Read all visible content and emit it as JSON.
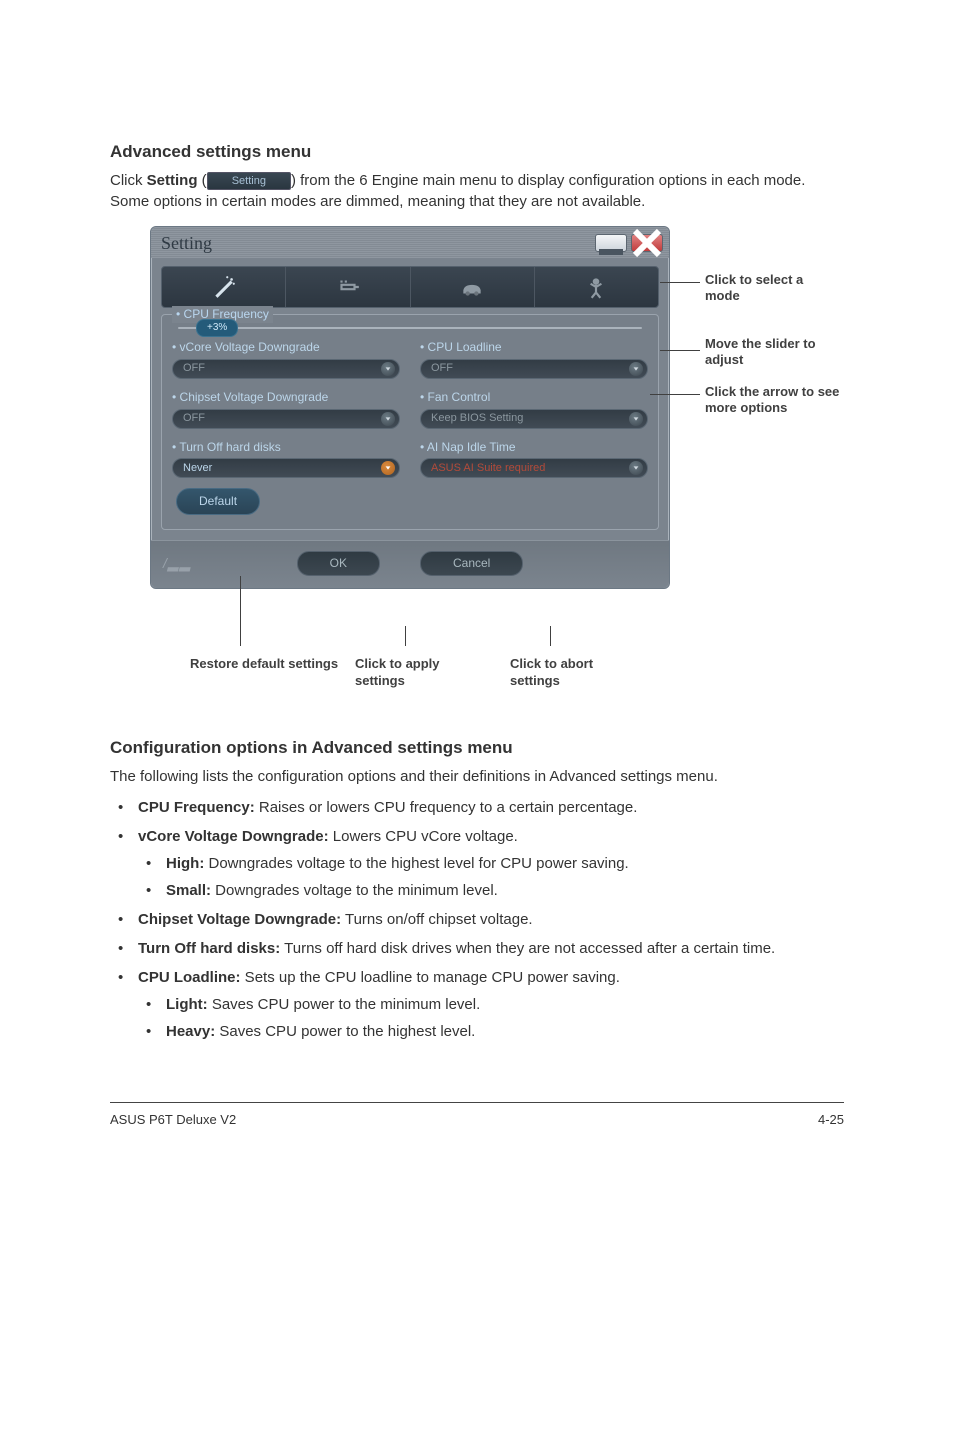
{
  "section1_title": "Advanced settings menu",
  "section1_p_prefix": "Click ",
  "section1_p_bold": "Setting",
  "section1_p_open": " (",
  "setting_btn_label": "Setting",
  "section1_p_rest": ") from the 6 Engine main menu to display configuration options in each mode. Some options in certain modes are dimmed, meaning that they are not available.",
  "window": {
    "title": "Setting",
    "group_title": "• CPU Frequency",
    "slider_value": "+3%",
    "opts": {
      "vcore_label": "• vCore Voltage Downgrade",
      "vcore_value": "OFF",
      "loadline_label": "• CPU Loadline",
      "loadline_value": "OFF",
      "chipset_label": "• Chipset Voltage Downgrade",
      "chipset_value": "OFF",
      "fan_label": "• Fan Control",
      "fan_value": "Keep BIOS Setting",
      "turnoff_label": "• Turn Off hard disks",
      "turnoff_value": "Never",
      "ainap_label": "• AI Nap Idle Time",
      "ainap_value": "ASUS AI Suite required"
    },
    "default_btn": "Default",
    "ok_btn": "OK",
    "cancel_btn": "Cancel"
  },
  "callouts": {
    "select_mode": "Click to select a mode",
    "move_slider": "Move the slider to adjust",
    "click_arrow": "Click the arrow to see more options",
    "restore": "Restore default settings",
    "apply": "Click to apply settings",
    "abort": "Click to abort settings"
  },
  "section2_title": "Configuration options in Advanced settings menu",
  "section2_p": "The following lists the configuration options and their definitions in Advanced settings menu.",
  "bullets": {
    "cpu_freq_b": "CPU Frequency:",
    "cpu_freq_t": " Raises or lowers CPU frequency to a certain percentage.",
    "vcore_b": "vCore Voltage Downgrade:",
    "vcore_t": " Lowers CPU vCore voltage.",
    "high_b": "High:",
    "high_t": " Downgrades voltage to the highest level for CPU power saving.",
    "small_b": "Small:",
    "small_t": " Downgrades voltage to the minimum level.",
    "chipset_b": "Chipset Voltage Downgrade:",
    "chipset_t": " Turns on/off chipset voltage.",
    "turnoff_b": "Turn Off hard disks:",
    "turnoff_t": " Turns off hard disk drives when they are not accessed after a certain time.",
    "loadline_b": "CPU Loadline:",
    "loadline_t": " Sets up the CPU loadline to manage CPU power saving.",
    "light_b": "Light:",
    "light_t": " Saves CPU power to the minimum level.",
    "heavy_b": "Heavy:",
    "heavy_t": " Saves CPU power to the highest level."
  },
  "footer_left": "ASUS P6T Deluxe V2",
  "footer_right": "4-25"
}
